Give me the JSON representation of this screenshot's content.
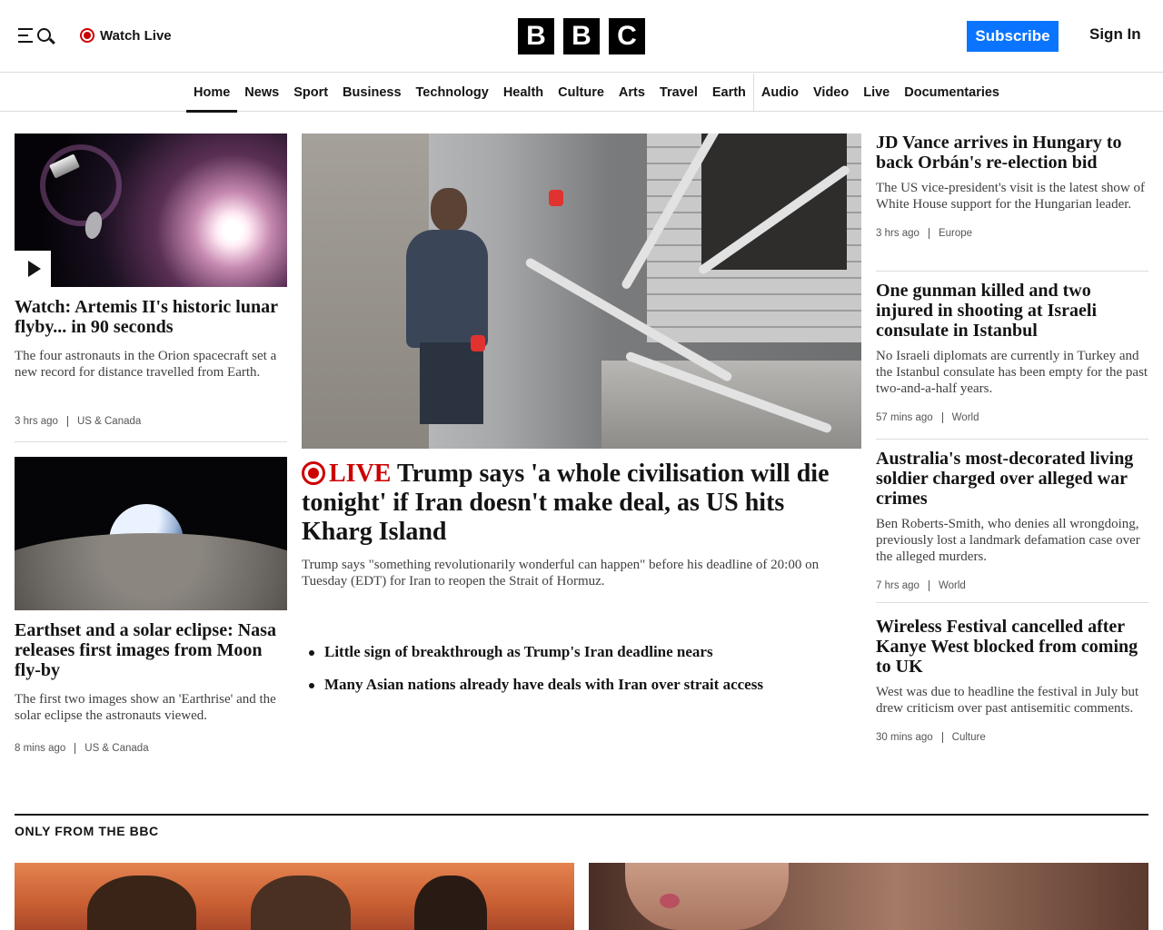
{
  "header": {
    "watch_live": "Watch Live",
    "logo_letters": [
      "B",
      "B",
      "C"
    ],
    "subscribe": "Subscribe",
    "sign_in": "Sign In"
  },
  "nav": {
    "items": [
      "Home",
      "News",
      "Sport",
      "Business",
      "Technology",
      "Health",
      "Culture",
      "Arts",
      "Travel",
      "Earth",
      "Audio",
      "Video",
      "Live",
      "Documentaries"
    ],
    "active": "Home"
  },
  "left": {
    "story1": {
      "headline": "Watch: Artemis II's historic lunar flyby... in 90 seconds",
      "summary": "The four astronauts in the Orion spacecraft set a new record for distance travelled from Earth.",
      "time": "3 hrs ago",
      "category": "US & Canada"
    },
    "story2": {
      "headline": "Earthset and a solar eclipse: Nasa releases first images from Moon fly-by",
      "summary": "The first two images show an 'Earthrise' and the solar eclipse the astronauts viewed.",
      "time": "8 mins ago",
      "category": "US & Canada"
    }
  },
  "lead": {
    "live_label": "LIVE",
    "headline": "Trump says 'a whole civilisation will die tonight' if Iran doesn't make deal, as US hits Kharg Island",
    "summary": "Trump says \"something revolutionarily wonderful can happen\" before his deadline of 20:00 on Tuesday (EDT) for Iran to reopen the Strait of Hormuz.",
    "related": [
      "Little sign of breakthrough as Trump's Iran deadline nears",
      "Many Asian nations already have deals with Iran over strait access"
    ]
  },
  "right": [
    {
      "headline": "JD Vance arrives in Hungary to back Orbán's re-election bid",
      "summary": "The US vice-president's visit is the latest show of White House support for the Hungarian leader.",
      "time": "3 hrs ago",
      "category": "Europe"
    },
    {
      "headline": "One gunman killed and two injured in shooting at Israeli consulate in Istanbul",
      "summary": "No Israeli diplomats are currently in Turkey and the Istanbul consulate has been empty for the past two-and-a-half years.",
      "time": "57 mins ago",
      "category": "World"
    },
    {
      "headline": "Australia's most-decorated living soldier charged over alleged war crimes",
      "summary": "Ben Roberts-Smith, who denies all wrongdoing, previously lost a landmark defamation case over the alleged murders.",
      "time": "7 hrs ago",
      "category": "World"
    },
    {
      "headline": "Wireless Festival cancelled after Kanye West blocked from coming to UK",
      "summary": "West was due to headline the festival in July but drew criticism over past antisemitic comments.",
      "time": "30 mins ago",
      "category": "Culture"
    }
  ],
  "only_from_bbc": {
    "title": "ONLY FROM THE BBC"
  },
  "icons": {
    "menu": "menu-icon",
    "search": "search-icon",
    "live": "live-dot-icon",
    "play": "play-icon"
  },
  "colors": {
    "live_red": "#cc0000",
    "subscribe_blue": "#0a74ff",
    "text": "#141414"
  }
}
